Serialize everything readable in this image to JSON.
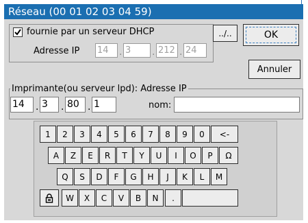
{
  "window": {
    "title": "Réseau (00 01 02 03 04 59)"
  },
  "dhcp": {
    "checkbox_label": "fournie par un serveur DHCP",
    "checked": true,
    "browse_label": "../..",
    "ip_label": "Adresse IP",
    "ip": [
      "14",
      "3",
      "212",
      "24"
    ]
  },
  "buttons": {
    "ok": "OK",
    "cancel": "Annuler"
  },
  "printer": {
    "group_label": "Imprimante(ou serveur lpd): Adresse IP",
    "ip": [
      "14",
      "3",
      "80",
      "1"
    ],
    "name_label": "nom:",
    "name_value": ""
  },
  "keyboard": {
    "row1": [
      "1",
      "2",
      "3",
      "4",
      "5",
      "6",
      "7",
      "8",
      "9",
      "0",
      "<-"
    ],
    "row2": [
      "A",
      "Z",
      "E",
      "R",
      "T",
      "Y",
      "U",
      "I",
      "O",
      "P",
      "Ω"
    ],
    "row3": [
      "Q",
      "S",
      "D",
      "F",
      "G",
      "H",
      "J",
      "K",
      "L",
      "M"
    ],
    "row4": [
      "W",
      "X",
      "C",
      "V",
      "B",
      "N",
      "."
    ],
    "space": ""
  },
  "icons": {
    "checkbox": "checkmark-icon",
    "shift": "lock-icon"
  }
}
